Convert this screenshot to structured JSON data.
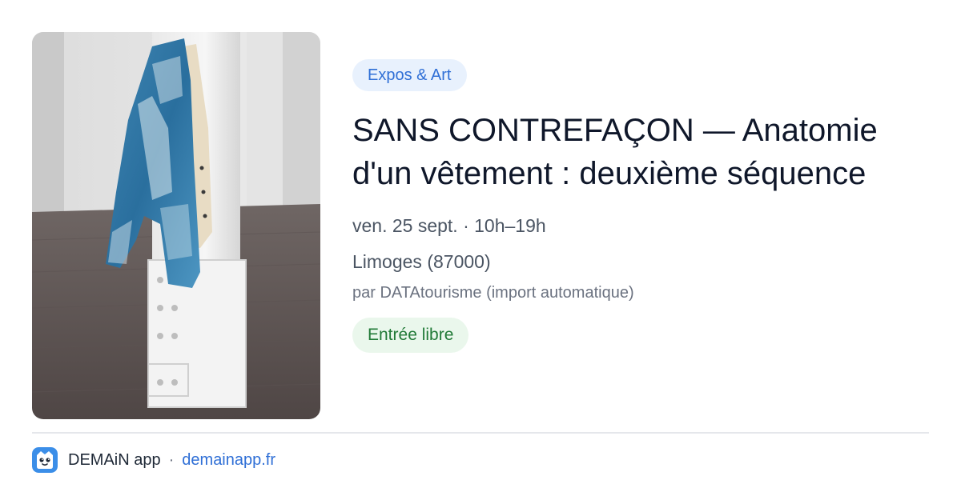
{
  "event": {
    "category": "Expos & Art",
    "title": "SANS CONTREFAÇON — Anatomie d'un vêtement : deuxième séquence",
    "datetime": "ven. 25 sept. · 10h–19h",
    "location": "Limoges (87000)",
    "source": "par DATAtourisme (import automatique)",
    "price": "Entrée libre",
    "image_icon": "photo-denim-jacket-on-pillar"
  },
  "footer": {
    "app_name": "DEMAiN app",
    "separator": "·",
    "url": "demainapp.fr",
    "logo_icon": "demain-logo-icon"
  },
  "colors": {
    "accent_blue": "#2f6fd6",
    "category_bg": "#e8f1fd",
    "price_green": "#217a37",
    "price_bg": "#eaf7ec",
    "title": "#0f172a",
    "muted": "#4b5563"
  }
}
